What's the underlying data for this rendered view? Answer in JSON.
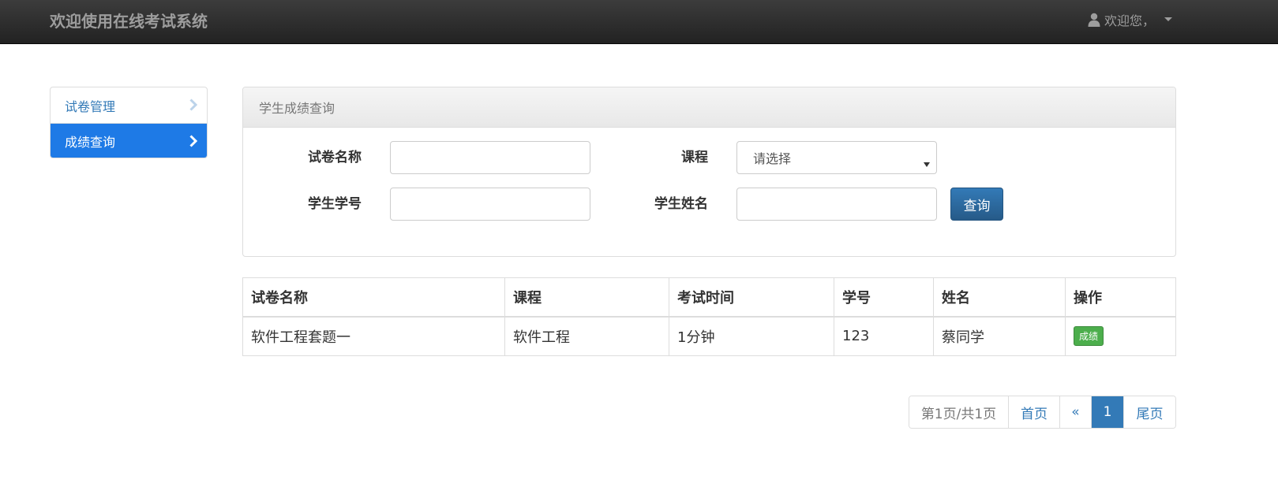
{
  "navbar": {
    "brand": "欢迎使用在线考试系统",
    "user_greeting": "欢迎您，",
    "user_icon": "user-icon",
    "caret_icon": "caret-down-icon"
  },
  "sidebar": {
    "items": [
      {
        "label": "试卷管理",
        "active": false,
        "icon": "chevron-right-icon"
      },
      {
        "label": "成绩查询",
        "active": true,
        "icon": "chevron-right-icon"
      }
    ]
  },
  "search_panel": {
    "title": "学生成绩查询",
    "fields": {
      "exam_name_label": "试卷名称",
      "exam_name_value": "",
      "course_label": "课程",
      "course_selected": "请选择",
      "student_id_label": "学生学号",
      "student_id_value": "",
      "student_name_label": "学生姓名",
      "student_name_value": ""
    },
    "query_button": "查询"
  },
  "table": {
    "headers": [
      "试卷名称",
      "课程",
      "考试时间",
      "学号",
      "姓名",
      "操作"
    ],
    "rows": [
      {
        "exam_name": "软件工程套题一",
        "course": "软件工程",
        "exam_time": "1分钟",
        "student_id": "123",
        "student_name": "蔡同学",
        "action": "成绩"
      }
    ]
  },
  "pagination": {
    "info": "第1页/共1页",
    "first": "首页",
    "prev": "«",
    "current": "1",
    "last": "尾页"
  },
  "colors": {
    "navbar": "#222222",
    "accent": "#337ab7",
    "sidebar_active": "#1e7ae6",
    "success": "#4cae4c"
  }
}
